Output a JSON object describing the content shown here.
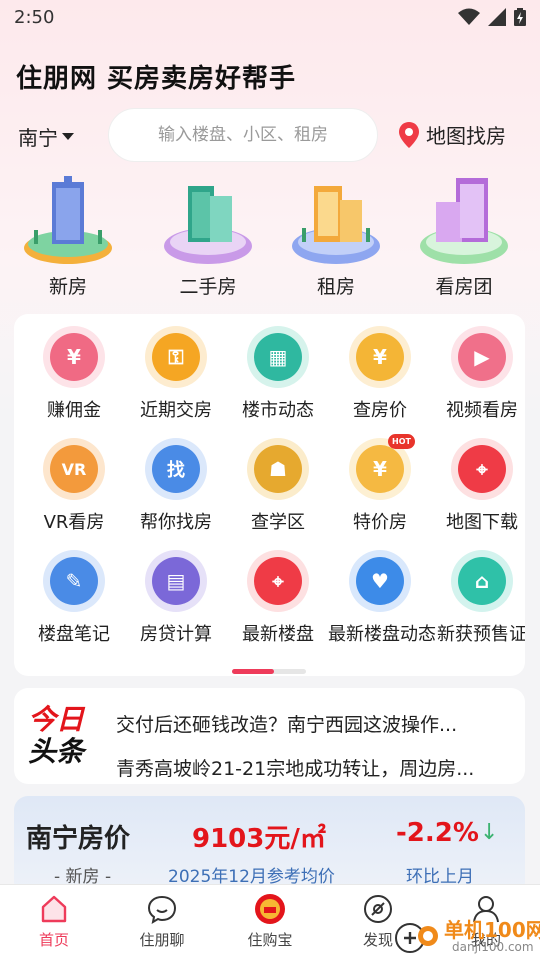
{
  "status": {
    "time": "2:50"
  },
  "header": {
    "title": "住朋网 买房卖房好帮手"
  },
  "search": {
    "city": "南宁",
    "placeholder": "输入楼盘、小区、租房",
    "map_label": "地图找房"
  },
  "main_categories": [
    {
      "label": "新房",
      "icon": "new-house-icon",
      "color": "#5b7bd6"
    },
    {
      "label": "二手房",
      "icon": "second-hand-house-icon",
      "color": "#2fa58a"
    },
    {
      "label": "租房",
      "icon": "rent-house-icon",
      "color": "#f3a93b"
    },
    {
      "label": "看房团",
      "icon": "viewing-group-icon",
      "color": "#b46cd9"
    }
  ],
  "grid_items": [
    {
      "label": "赚佣金",
      "icon": "commission-icon",
      "color": "#f06a84",
      "glyph": "¥"
    },
    {
      "label": "近期交房",
      "icon": "delivery-key-icon",
      "color": "#f5a623",
      "glyph": "⚿"
    },
    {
      "label": "楼市动态",
      "icon": "market-news-icon",
      "color": "#2fb8a0",
      "glyph": "▦"
    },
    {
      "label": "查房价",
      "icon": "price-check-icon",
      "color": "#f4b536",
      "glyph": "¥"
    },
    {
      "label": "视频看房",
      "icon": "video-house-icon",
      "color": "#f0708a",
      "glyph": "▶"
    },
    {
      "label": "VR看房",
      "icon": "vr-house-icon",
      "color": "#f39a3c",
      "glyph": "VR"
    },
    {
      "label": "帮你找房",
      "icon": "find-house-icon",
      "color": "#4a8be6",
      "glyph": "找"
    },
    {
      "label": "查学区",
      "icon": "school-district-icon",
      "color": "#e6a92f",
      "glyph": "☗"
    },
    {
      "label": "特价房",
      "icon": "special-price-icon",
      "color": "#f5b942",
      "glyph": "¥",
      "badge": "HOT"
    },
    {
      "label": "地图下载",
      "icon": "map-download-icon",
      "color": "#ef3b46",
      "glyph": "⌖"
    },
    {
      "label": "楼盘笔记",
      "icon": "notes-icon",
      "color": "#4a8be6",
      "glyph": "✎"
    },
    {
      "label": "房贷计算",
      "icon": "loan-calculator-icon",
      "color": "#7b68d8",
      "glyph": "▤"
    },
    {
      "label": "最新楼盘",
      "icon": "latest-property-icon",
      "color": "#ef3b46",
      "glyph": "⌖"
    },
    {
      "label": "最新楼盘动态",
      "icon": "property-news-icon",
      "color": "#3d8be8",
      "glyph": "♥"
    },
    {
      "label": "新获预售证",
      "icon": "presale-permit-icon",
      "color": "#2fc1a8",
      "glyph": "⌂"
    }
  ],
  "news": {
    "logo_line1": "今日",
    "logo_line2": "头条",
    "items": [
      "交付后还砸钱改造？南宁西园这波操作...",
      "青秀高坡岭21-21宗地成功转让，周边房..."
    ]
  },
  "price": {
    "title": "南宁房价",
    "value": "9103元/㎡",
    "change": "-2.2%",
    "type_label": "- 新房 -",
    "date_label": "2025年12月参考均价",
    "compare_label": "环比上月"
  },
  "bottom_nav": [
    {
      "label": "首页",
      "icon": "home-icon",
      "active": true
    },
    {
      "label": "住朋聊",
      "icon": "chat-icon",
      "active": false
    },
    {
      "label": "住购宝",
      "icon": "shopping-treasure-icon",
      "active": false
    },
    {
      "label": "发现",
      "icon": "discover-icon",
      "active": false
    },
    {
      "label": "我的",
      "icon": "profile-icon",
      "active": false
    }
  ],
  "watermark": {
    "text": "单机100网",
    "domain": "danji100.com"
  },
  "colors": {
    "accent": "#ee3b5a",
    "price_red": "#e3151b",
    "down_green": "#3cb371"
  }
}
